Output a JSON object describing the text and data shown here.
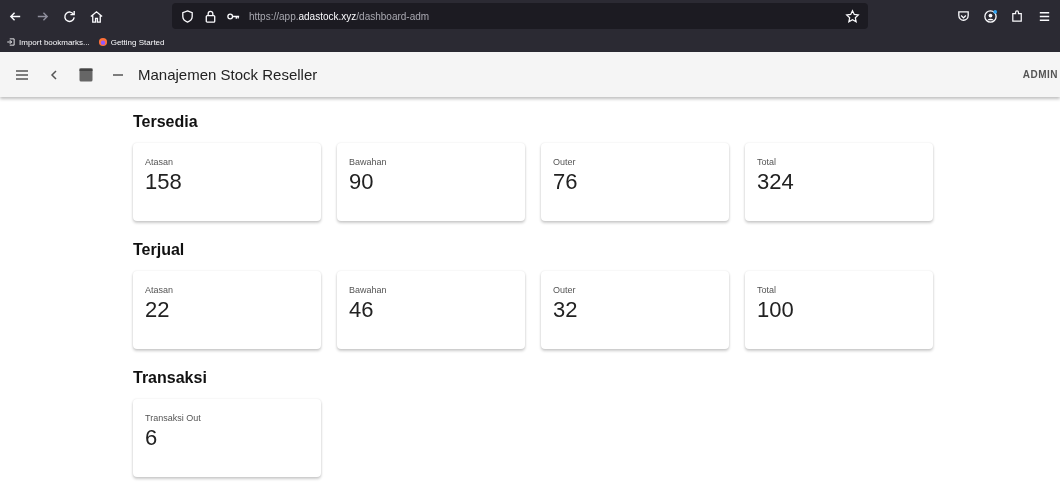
{
  "browser": {
    "url": "https://app.**adastock.xyz**/dashboard-adm",
    "bookmarks": [
      "Import bookmarks...",
      "Getting Started"
    ]
  },
  "app_bar": {
    "title": "Manajemen Stock Reseller",
    "user": "ADMIN"
  },
  "sections": [
    {
      "title": "Tersedia",
      "cards": [
        {
          "label": "Atasan",
          "value": "158"
        },
        {
          "label": "Bawahan",
          "value": "90"
        },
        {
          "label": "Outer",
          "value": "76"
        },
        {
          "label": "Total",
          "value": "324"
        }
      ]
    },
    {
      "title": "Terjual",
      "cards": [
        {
          "label": "Atasan",
          "value": "22"
        },
        {
          "label": "Bawahan",
          "value": "46"
        },
        {
          "label": "Outer",
          "value": "32"
        },
        {
          "label": "Total",
          "value": "100"
        }
      ]
    },
    {
      "title": "Transaksi",
      "cards": [
        {
          "label": "Transaksi Out",
          "value": "6"
        }
      ]
    }
  ]
}
